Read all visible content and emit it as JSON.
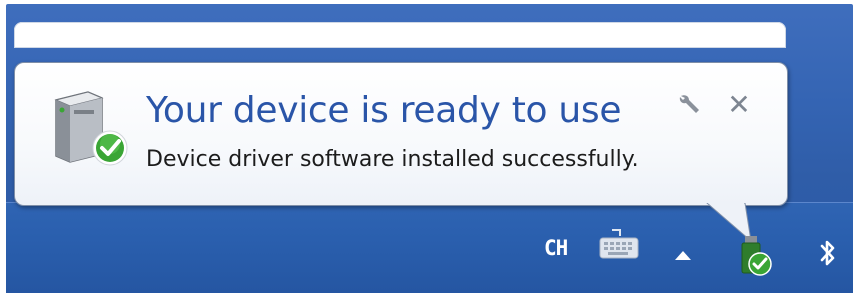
{
  "notification": {
    "title": "Your device is ready to use",
    "message": "Device driver software installed successfully.",
    "close_label": "✕",
    "icon": "device-driver-check-icon",
    "settings_icon": "wrench-icon"
  },
  "tray": {
    "language": "CH",
    "items": [
      "keyboard-icon",
      "show-hidden-icons-arrow",
      "usb-device-check-icon",
      "bluetooth-icon"
    ]
  },
  "colors": {
    "title": "#2a55a8",
    "taskbar": "#2a5fae",
    "balloon_border": "#7f8fa8",
    "check_green": "#3aa535"
  }
}
